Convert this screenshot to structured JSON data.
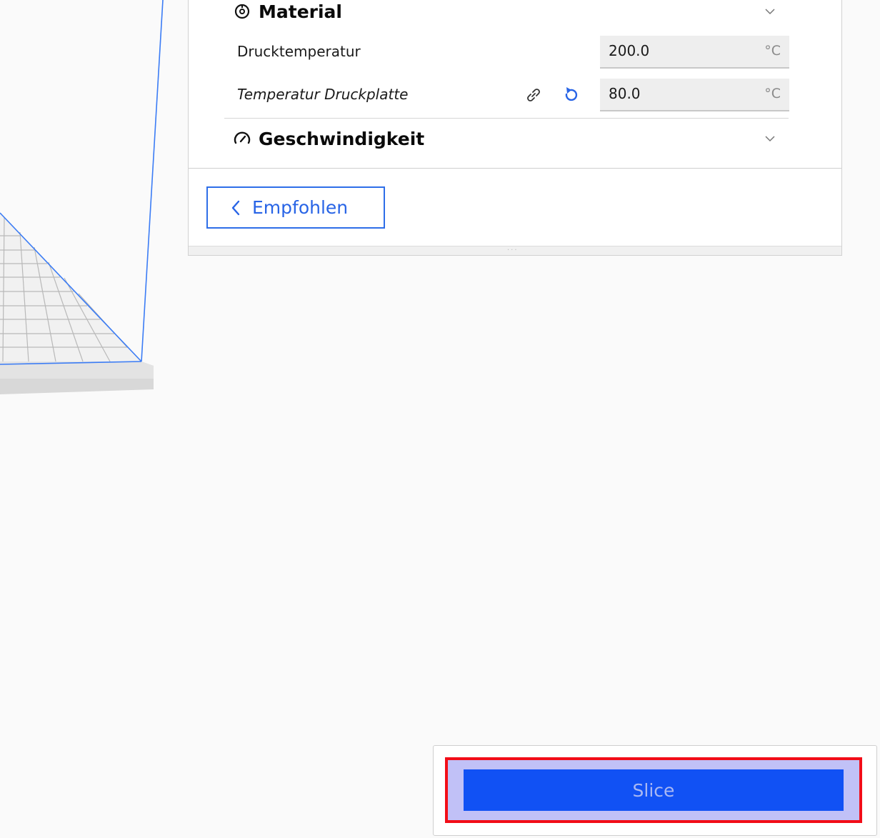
{
  "settings_panel": {
    "categories": {
      "material": {
        "title": "Material",
        "icon": "material-spool-icon"
      },
      "speed": {
        "title": "Geschwindigkeit",
        "icon": "speedometer-icon"
      }
    },
    "settings": {
      "print_temperature": {
        "label": "Drucktemperatur",
        "value": "200.0",
        "unit": "°C"
      },
      "build_plate_temperature": {
        "label": "Temperatur Druckplatte",
        "value": "80.0",
        "unit": "°C",
        "icons": [
          "link-icon",
          "reset-icon"
        ]
      }
    },
    "recommended_button": {
      "label": "Empfohlen",
      "icon": "chevron-left-icon"
    }
  },
  "action_panel": {
    "slice_button": {
      "label": "Slice"
    }
  },
  "colors": {
    "accent": "#2864e6",
    "slice_button": "#1151f4",
    "highlight_border": "#f20d18"
  }
}
